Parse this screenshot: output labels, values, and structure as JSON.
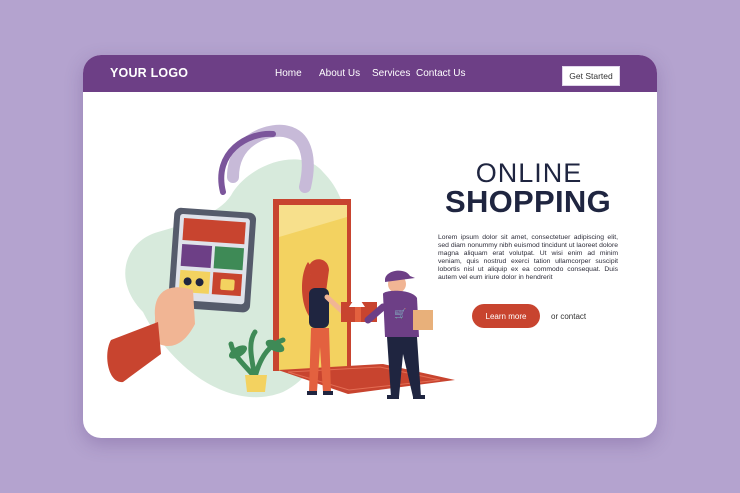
{
  "header": {
    "logo": "YOUR LOGO",
    "nav": [
      {
        "label": "Home"
      },
      {
        "label": "About Us"
      },
      {
        "label": "Services"
      },
      {
        "label": "Contact Us"
      }
    ],
    "cta_label": "Get Started"
  },
  "hero": {
    "title_line1": "ONLINE",
    "title_line2": "SHOPPING",
    "body": "Lorem ipsum dolor sit amet, consectetuer adipiscing elit, sed diam nonummy nibh euismod tincidunt ut laoreet dolore magna aliquam erat volutpat. Ut wisi enim ad minim veniam, quis nostrud exerci tation ullamcorper suscipit lobortis nisl ut aliquip ex ea commodo consequat. Duis autem vel eum iriure dolor in hendrerit",
    "primary_button": "Learn more",
    "secondary_link": "or contact"
  },
  "colors": {
    "background": "#b4a3cf",
    "navbar": "#6d3f86",
    "accent": "#c8442f",
    "title": "#1f2540"
  },
  "illustration": {
    "icons": [
      "shopping-bag-tag-shape",
      "smartphone-icon",
      "cart-icon",
      "sunglasses-icon",
      "handbag-icon",
      "plant-icon",
      "door-shape",
      "courier-figure",
      "woman-figure",
      "parcel-box-icon",
      "doormat-shape"
    ]
  }
}
